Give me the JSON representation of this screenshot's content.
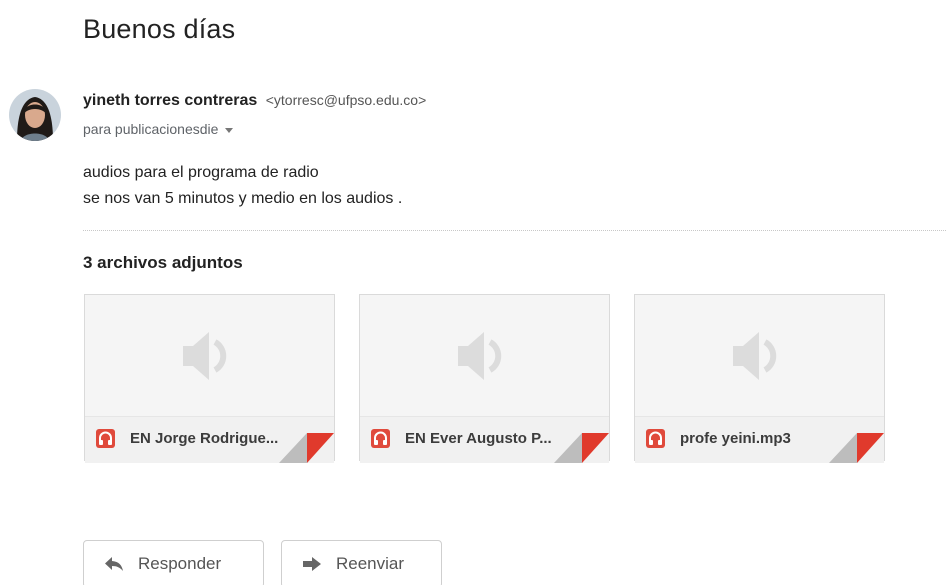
{
  "email": {
    "subject": "Buenos días",
    "sender": {
      "name": "yineth torres contreras",
      "email": "<ytorresc@ufpso.edu.co>"
    },
    "to": "para publicacionesdie",
    "body_lines": [
      "audios para el programa de radio",
      "se nos van 5 minutos y medio en los audios ."
    ]
  },
  "attachments": {
    "heading": "3 archivos adjuntos",
    "files": [
      {
        "name": "EN Jorge Rodrigue...",
        "icon": "audio-file-icon"
      },
      {
        "name": "EN Ever Augusto P...",
        "icon": "audio-file-icon"
      },
      {
        "name": "profe yeini.mp3",
        "icon": "audio-file-icon"
      }
    ]
  },
  "actions": {
    "reply_label": "Responder",
    "forward_label": "Reenviar"
  },
  "colors": {
    "audio_icon": "#e04a3c",
    "corner_red": "#e03a2c"
  }
}
